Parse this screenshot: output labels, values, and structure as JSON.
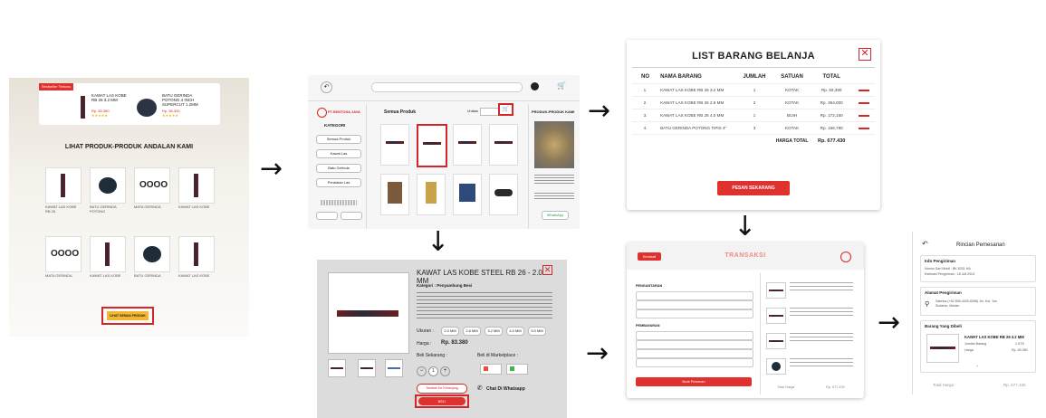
{
  "homepage": {
    "badge": "Bestseller Terbaru",
    "featured": [
      {
        "name": "KAWAT LAS KOBE RB 26 3.2 MM",
        "price": "Rp. 83.380"
      },
      {
        "name": "BATU GERINDA POTONG 4 INCH SUPERCUT 1.2MM",
        "price": "Rp. 56.300"
      }
    ],
    "heading": "LIHAT PRODUK-PRODUK ANDALAN KAMI",
    "button": "LIHAT SEMUA PRODUK"
  },
  "catalog": {
    "brand": "PT.SENTOSA JAYA",
    "categories_title": "KATEGORI",
    "categories": [
      "Semua Produk",
      "Kawat Las",
      "Batu Gerinda",
      "Peralatan Las"
    ],
    "section_title": "Semua Produk",
    "sort_label": "Urutkan",
    "right_title": "PRODUK-PRODUK KAMI",
    "whatsapp": "WhatsApp"
  },
  "cart": {
    "title": "LIST BARANG BELANJA",
    "headers": [
      "NO",
      "NAMA BARANG",
      "JUMLAH",
      "SATUAN",
      "TOTAL"
    ],
    "rows": [
      {
        "no": "1.",
        "name": "KAWAT LAS KOBE RB 26 3.2 MM",
        "qty": "1",
        "unit": "KOTAK",
        "total": "Rp. 83,380"
      },
      {
        "no": "2.",
        "name": "KAWAT LAS KOBE RB 26 2.6 MM",
        "qty": "2",
        "unit": "KOTAK",
        "total": "Rp. 364,000"
      },
      {
        "no": "3.",
        "name": "KAWAT LAS KOBE RB 26 4.0 MM",
        "qty": "1",
        "unit": "BIJIH",
        "total": "Rp. 172,150"
      },
      {
        "no": "4.",
        "name": "BATU GERINDA POTONG TIPIS 4\"",
        "qty": "3",
        "unit": "KOTAK",
        "total": "Rp. 156,780"
      }
    ],
    "grand_label": "HARGA TOTAL",
    "grand_total": "Rp. 677.430",
    "order_button": "PESAN SEKARANG"
  },
  "detail": {
    "title": "KAWAT LAS KOBE STEEL RB 26 - 2.0 MM",
    "category": "Kategori : Penyambung Besi",
    "size_label": "Ukuran :",
    "sizes": [
      "2.0 MM",
      "2.6 MM",
      "3.2 MM",
      "4.0 MM",
      "5.0 MM"
    ],
    "price_label": "Harga :",
    "price": "Rp. 83.380",
    "buy_now": "Beli Sekarang :",
    "marketplace": "Beli di Marketplace :",
    "cart_button": "Tambah Ke Keranjang",
    "buy_button": "BELI",
    "chat": "Chat Di Whatsapp"
  },
  "transaction": {
    "back": "Kembali",
    "title": "TRANSAKSI",
    "shipping": "PENGANTARAN",
    "payment": "PEMBAYARAN",
    "button": "Buat Pesanan",
    "total_label": "Total Harga",
    "total": "Rp. 677.430"
  },
  "order": {
    "title": "Rincian Pemesanan",
    "info_title": "Info Pengiriman",
    "info_lines": [
      "Nomor Dari Mobil : BK 8331 HA",
      "Estimasi Pengiriman : 18 Juli 2024"
    ],
    "address_title": "Alamat Pengiriman",
    "address": "Sabrina (+62 895-4420-6398) Jln. Kol. Yos Sudarso, Medan",
    "items_title": "Barang Yang Dibeli",
    "item_name": "KAWAT LAS KOBE RB 26 3.2 MM",
    "item_qty_label": "Jumlah Barang",
    "item_qty": "1 KTK",
    "item_price_label": "Harga",
    "item_price": "Rp. 83.380",
    "total_label": "Total Harga :",
    "total": "Rp. 677.430"
  },
  "colors": {
    "accent": "#e0312f",
    "border": "#cccccc",
    "panel": "#f4f4f4"
  }
}
